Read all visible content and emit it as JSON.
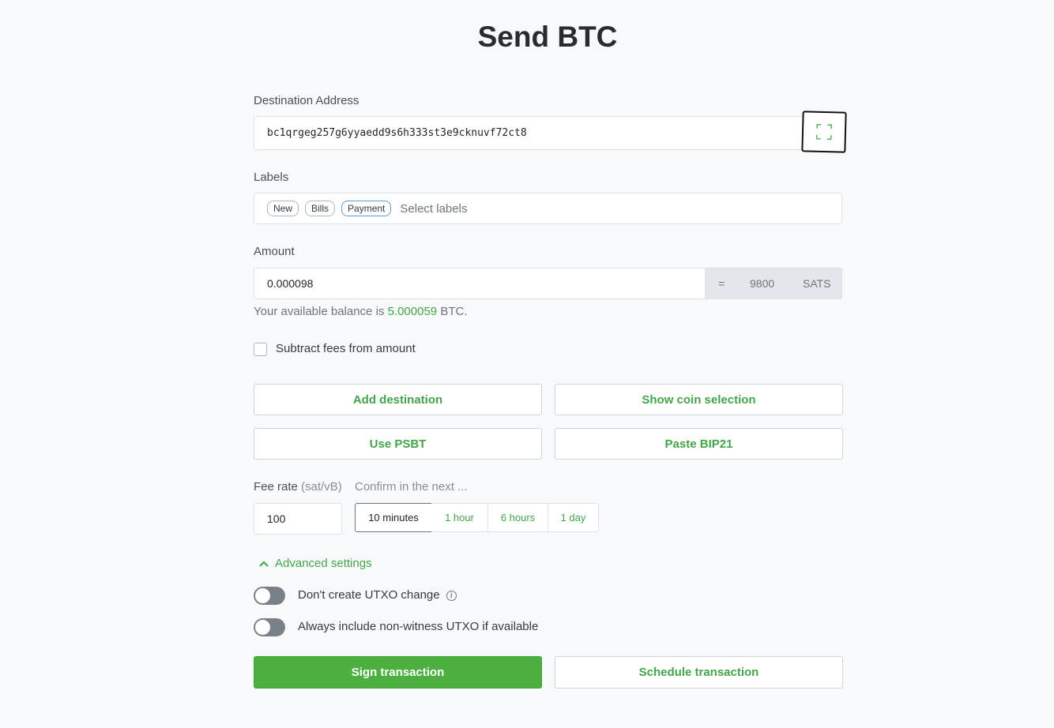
{
  "page": {
    "title": "Send BTC"
  },
  "destination": {
    "label": "Destination Address",
    "value": "bc1qrgeg257g6yyaedd9s6h333st3e9cknuvf72ct8",
    "scan_icon": "qr-scan-icon"
  },
  "labels": {
    "label": "Labels",
    "chips": [
      "New",
      "Bills",
      "Payment"
    ],
    "placeholder": "Select labels"
  },
  "amount": {
    "label": "Amount",
    "value": "0.000098",
    "equals": "=",
    "sats_value": "9800",
    "sats_unit": "SATS",
    "balance_prefix": "Your available balance is",
    "balance_value": "5.000059",
    "balance_suffix": "BTC."
  },
  "subtract_fees": {
    "label": "Subtract fees from amount",
    "checked": false
  },
  "actions": {
    "add_destination": "Add destination",
    "show_coin_selection": "Show coin selection",
    "use_psbt": "Use PSBT",
    "paste_bip21": "Paste BIP21"
  },
  "fee": {
    "label": "Fee rate",
    "unit": "(sat/vB)",
    "value": "100",
    "confirm_label": "Confirm in the next ...",
    "options": [
      "10 minutes",
      "1 hour",
      "6 hours",
      "1 day"
    ],
    "selected": "10 minutes"
  },
  "advanced": {
    "toggle_label": "Advanced settings",
    "no_change_label": "Don't create UTXO change",
    "non_witness_label": "Always include non-witness UTXO if available"
  },
  "footer": {
    "sign": "Sign transaction",
    "schedule": "Schedule transaction"
  },
  "colors": {
    "accent": "#44a44a",
    "primary_button": "#4caf3f"
  }
}
